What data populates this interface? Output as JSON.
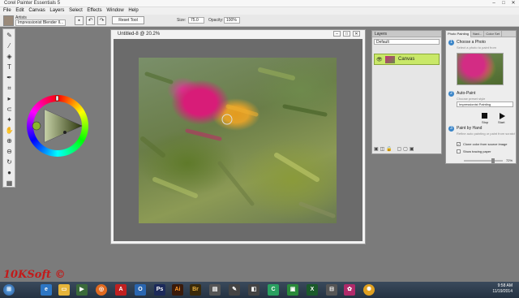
{
  "app": {
    "title": "Corel Painter Essentials 5",
    "window_buttons": [
      "–",
      "□",
      "✕"
    ]
  },
  "menu": [
    "File",
    "Edit",
    "Canvas",
    "Layers",
    "Select",
    "Effects",
    "Window",
    "Help"
  ],
  "propbar": {
    "brush_category": "Artists",
    "brush_variant": "Impressionist Blender Il...",
    "reset_label": "Reset Tool",
    "size_label": "Size:",
    "size_value": "75.0",
    "opacity_label": "Opacity:",
    "opacity_value": "100%"
  },
  "document": {
    "title": "Untitled-8 @ 20.2%"
  },
  "layers": {
    "tab": "Layers",
    "composite": "Default",
    "layer_name": "Canvas"
  },
  "photo_painting": {
    "tabs": [
      "Photo Painting",
      "Navi...",
      "Color Set"
    ],
    "step1_title": "Choose a Photo",
    "step1_sub": "Select a photo to paint from",
    "step2_title": "Auto-Paint",
    "step2_sub": "Choose preset style",
    "style_value": "Impressionist Painting",
    "stop_label": "Stop",
    "start_label": "Start",
    "step3_title": "Paint by Hand",
    "step3_sub": "Refine auto painting or paint from scratch",
    "clone_label": "Clone color from source image",
    "trace_label": "Show tracing paper",
    "trace_value": "72%"
  },
  "watermark": "10KSoft ©",
  "taskbar": {
    "time": "9:58 AM",
    "date": "11/19/2014"
  }
}
